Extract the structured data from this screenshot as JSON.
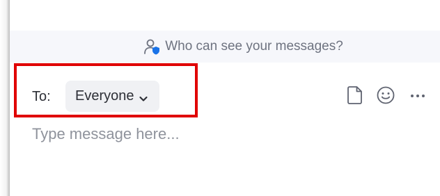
{
  "privacy_bar": {
    "text": "Who can see your messages?",
    "icon": "user-shield-icon"
  },
  "compose": {
    "to_label": "To:",
    "recipient": "Everyone",
    "recipient_icon": "chevron-down-icon",
    "message_placeholder": "Type message here...",
    "tools": [
      "file-icon",
      "emoji-icon",
      "more-icon"
    ],
    "tool_more_glyph": "···"
  },
  "colors": {
    "highlight": "#e00000",
    "accent_blue": "#1a73e8",
    "bar_background": "#f6f7fb",
    "chip_background": "#f0f1f4"
  }
}
